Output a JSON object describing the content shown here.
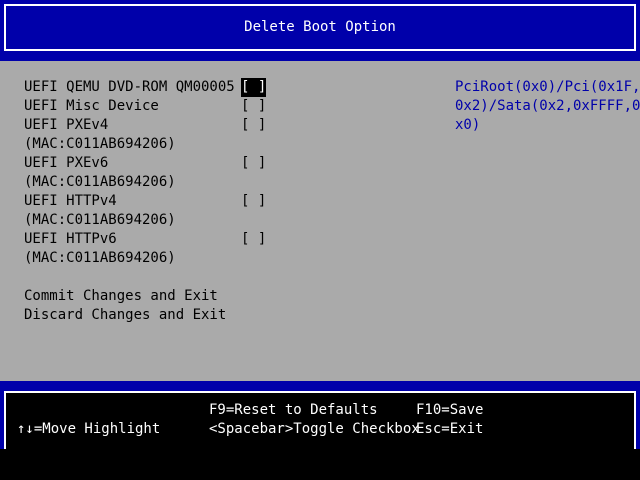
{
  "title": "Delete Boot Option",
  "items": [
    {
      "label": "UEFI QEMU DVD-ROM QM00005",
      "checkbox": "[ ]",
      "selected": true
    },
    {
      "label": "UEFI Misc Device",
      "checkbox": "[ ]",
      "selected": false
    },
    {
      "label": "UEFI PXEv4",
      "checkbox": "[ ]",
      "selected": false
    },
    {
      "label": "(MAC:C011AB694206)",
      "checkbox": "",
      "selected": false
    },
    {
      "label": "UEFI PXEv6",
      "checkbox": "[ ]",
      "selected": false
    },
    {
      "label": "(MAC:C011AB694206)",
      "checkbox": "",
      "selected": false
    },
    {
      "label": "UEFI HTTPv4",
      "checkbox": "[ ]",
      "selected": false
    },
    {
      "label": "(MAC:C011AB694206)",
      "checkbox": "",
      "selected": false
    },
    {
      "label": "UEFI HTTPv6",
      "checkbox": "[ ]",
      "selected": false
    },
    {
      "label": "(MAC:C011AB694206)",
      "checkbox": "",
      "selected": false
    }
  ],
  "actions": {
    "commit": "Commit Changes and Exit",
    "discard": "Discard Changes and Exit"
  },
  "help_text": [
    "PciRoot(0x0)/Pci(0x1F,",
    "0x2)/Sata(0x2,0xFFFF,0",
    "x0)"
  ],
  "footer": {
    "move_highlight": "↑↓=Move Highlight",
    "reset_defaults": "F9=Reset to Defaults",
    "toggle_checkbox": "<Spacebar>Toggle Checkbox",
    "save": "F10=Save",
    "exit": "Esc=Exit"
  },
  "colors": {
    "title_bg": "#0000aa",
    "body_bg": "#aaaaaa",
    "help_text": "#0000aa",
    "footer_bg": "#000000",
    "text": "#000000",
    "inverse_text": "#ffffff"
  }
}
